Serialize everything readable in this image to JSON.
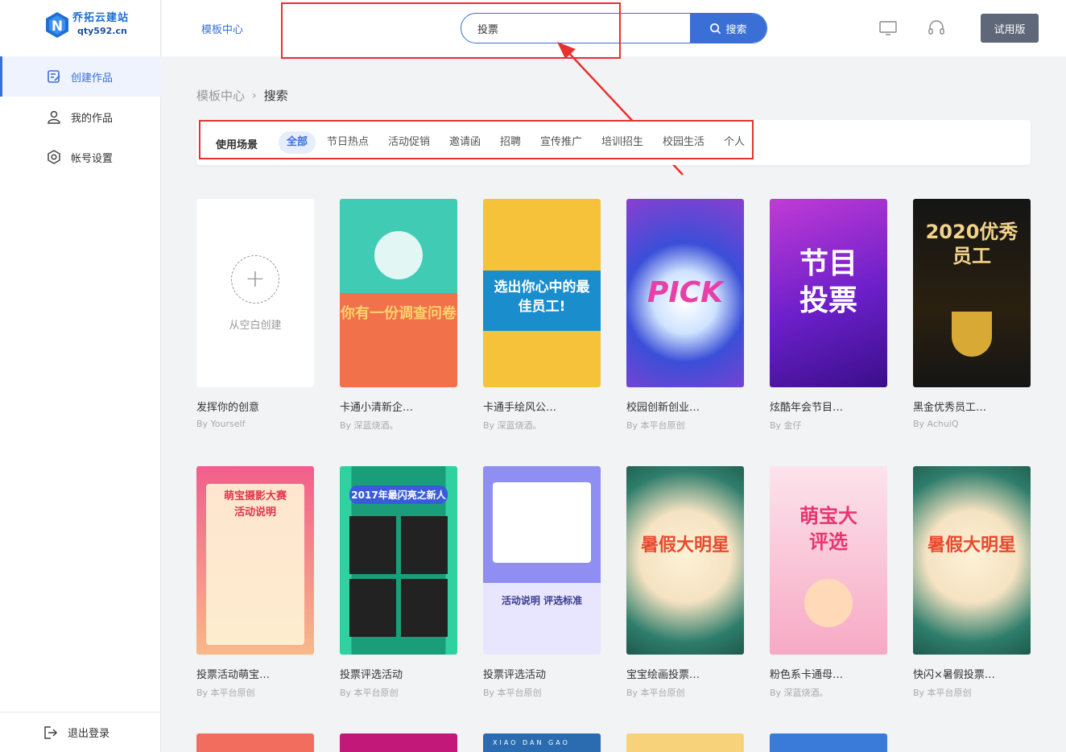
{
  "brand": {
    "name": "乔拓云建站",
    "url": "qty592.cn",
    "logo_letter": "N"
  },
  "sidebar": {
    "items": [
      {
        "label": "创建作品",
        "icon": "edit-icon",
        "active": true
      },
      {
        "label": "我的作品",
        "icon": "user-icon",
        "active": false
      },
      {
        "label": "帐号设置",
        "icon": "settings-icon",
        "active": false
      }
    ],
    "logout_label": "退出登录"
  },
  "header": {
    "link": "模板中心",
    "search_value": "投票",
    "search_button": "搜索",
    "trial_button": "试用版"
  },
  "breadcrumb": {
    "root": "模板中心",
    "separator": "›",
    "current": "搜索"
  },
  "filters": {
    "label": "使用场景",
    "tabs": [
      "全部",
      "节日热点",
      "活动促销",
      "邀请函",
      "招聘",
      "宣传推广",
      "培训招生",
      "校园生活",
      "个人"
    ],
    "active": "全部"
  },
  "blank_card": {
    "text": "从空白创建",
    "title": "发挥你的创意",
    "author": "By Yourself"
  },
  "templates": [
    {
      "title": "卡通小清新企…",
      "author": "By 深蓝烧酒。",
      "text": "你有一份调查问卷",
      "colors": [
        "#3fcbb4",
        "#f0714a"
      ]
    },
    {
      "title": "卡通手绘风公…",
      "author": "By 深蓝烧酒。",
      "text": "选出你心中的最佳员工!",
      "colors": [
        "#f5c23a",
        "#1a8ecc"
      ]
    },
    {
      "title": "校园创新创业…",
      "author": "By 本平台原创",
      "text": "PICK",
      "colors": [
        "#3b4fd8",
        "#8a3fd1"
      ]
    },
    {
      "title": "炫酷年会节目…",
      "author": "By 金仔",
      "text": "节目投票",
      "colors": [
        "#6b1fc9",
        "#c13bd6"
      ]
    },
    {
      "title": "黑金优秀员工…",
      "author": "By AchuiQ",
      "text": "2020优秀员工",
      "colors": [
        "#151515",
        "#3a2c10"
      ]
    },
    {
      "title": "投票活动萌宝…",
      "author": "By 本平台原创",
      "text": "萌宝摄影大赛活动说明",
      "colors": [
        "#f25e8c",
        "#f7b98a"
      ]
    },
    {
      "title": "投票评选活动",
      "author": "By 本平台原创",
      "text": "2017年最闪亮之新人",
      "colors": [
        "#2fd1a0",
        "#1a9e7a"
      ]
    },
    {
      "title": "投票评选活动",
      "author": "By 本平台原创",
      "text": "活动说明 评选标准",
      "colors": [
        "#8f8ef2",
        "#e8e6ff"
      ]
    },
    {
      "title": "宝宝绘画投票…",
      "author": "By 本平台原创",
      "text": "暑假大明星",
      "colors": [
        "#f5e3c2",
        "#f0a030"
      ]
    },
    {
      "title": "粉色系卡通母…",
      "author": "By 深蓝烧酒。",
      "text": "萌宝大评选",
      "colors": [
        "#f7a9c4",
        "#fce3ec"
      ]
    },
    {
      "title": "快闪×暑假投票…",
      "author": "By 本平台原创",
      "text": "暑假大明星",
      "colors": [
        "#f5e3c2",
        "#f0a030"
      ]
    }
  ],
  "partial_row": [
    {
      "colors": [
        "#f26d5e"
      ],
      "text": ""
    },
    {
      "colors": [
        "#c2187a"
      ],
      "text": ""
    },
    {
      "colors": [
        "#2b6cb0"
      ],
      "text": "XIAO DAN GAO"
    },
    {
      "colors": [
        "#f7d27a"
      ],
      "text": ""
    },
    {
      "colors": [
        "#3a7ad9"
      ],
      "text": ""
    }
  ]
}
